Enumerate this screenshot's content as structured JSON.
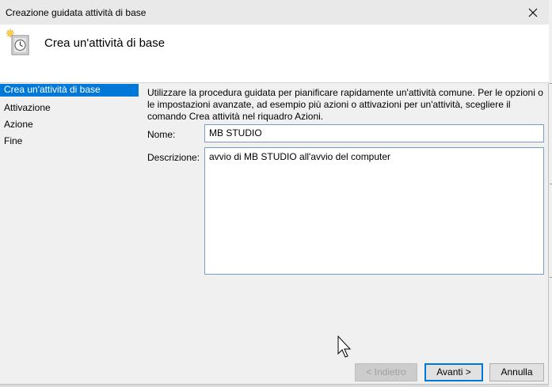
{
  "window": {
    "title": "Creazione guidata attività di base"
  },
  "header": {
    "title": "Crea un'attività di base"
  },
  "sidebar": {
    "items": [
      {
        "label": "Crea un'attività di base",
        "selected": true
      },
      {
        "label": "Attivazione",
        "selected": false
      },
      {
        "label": "Azione",
        "selected": false
      },
      {
        "label": "Fine",
        "selected": false
      }
    ]
  },
  "content": {
    "intro": "Utilizzare la procedura guidata per pianificare rapidamente un'attività comune. Per le opzioni o le impostazioni avanzate, ad esempio più azioni o attivazioni per un'attività, scegliere il comando Crea attività nel riquadro Azioni.",
    "name_label": "Nome:",
    "name_value": "MB STUDIO",
    "description_label": "Descrizione:",
    "description_value": "avvio di MB STUDIO all'avvio del computer"
  },
  "buttons": {
    "back": "< Indietro",
    "next": "Avanti >",
    "cancel": "Annulla"
  },
  "colors": {
    "accent": "#0078d7",
    "titlebar": "#e9e9e9",
    "window_bg": "#f0f0f0"
  }
}
